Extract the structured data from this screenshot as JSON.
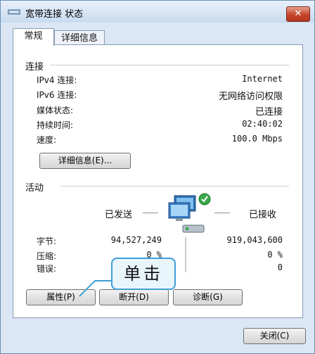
{
  "window": {
    "title": "宽带连接 状态",
    "close_label": "✕"
  },
  "tabs": [
    {
      "label": "常规"
    },
    {
      "label": "详细信息"
    }
  ],
  "connection": {
    "heading": "连接",
    "rows": [
      {
        "label": "IPv4 连接:",
        "value": "Internet"
      },
      {
        "label": "IPv6 连接:",
        "value": "无网络访问权限"
      },
      {
        "label": "媒体状态:",
        "value": "已连接"
      },
      {
        "label": "持续时间:",
        "value": "02:40:02"
      },
      {
        "label": "速度:",
        "value": "100.0 Mbps"
      }
    ],
    "details_button": "详细信息(E)..."
  },
  "activity": {
    "heading": "活动",
    "sent_label": "已发送",
    "received_label": "已接收",
    "rows": [
      {
        "label": "字节:",
        "sent": "94,527,249",
        "received": "919,043,600"
      },
      {
        "label": "压缩:",
        "sent": "0 %",
        "received": "0 %"
      },
      {
        "label": "错误:",
        "sent": "",
        "received": "0"
      }
    ]
  },
  "buttons": {
    "properties": "属性(P)",
    "disconnect": "断开(D)",
    "diagnose": "诊断(G)",
    "close": "关闭(C)"
  },
  "annotation": {
    "text": "单击",
    "color": "#3d9fd6"
  }
}
